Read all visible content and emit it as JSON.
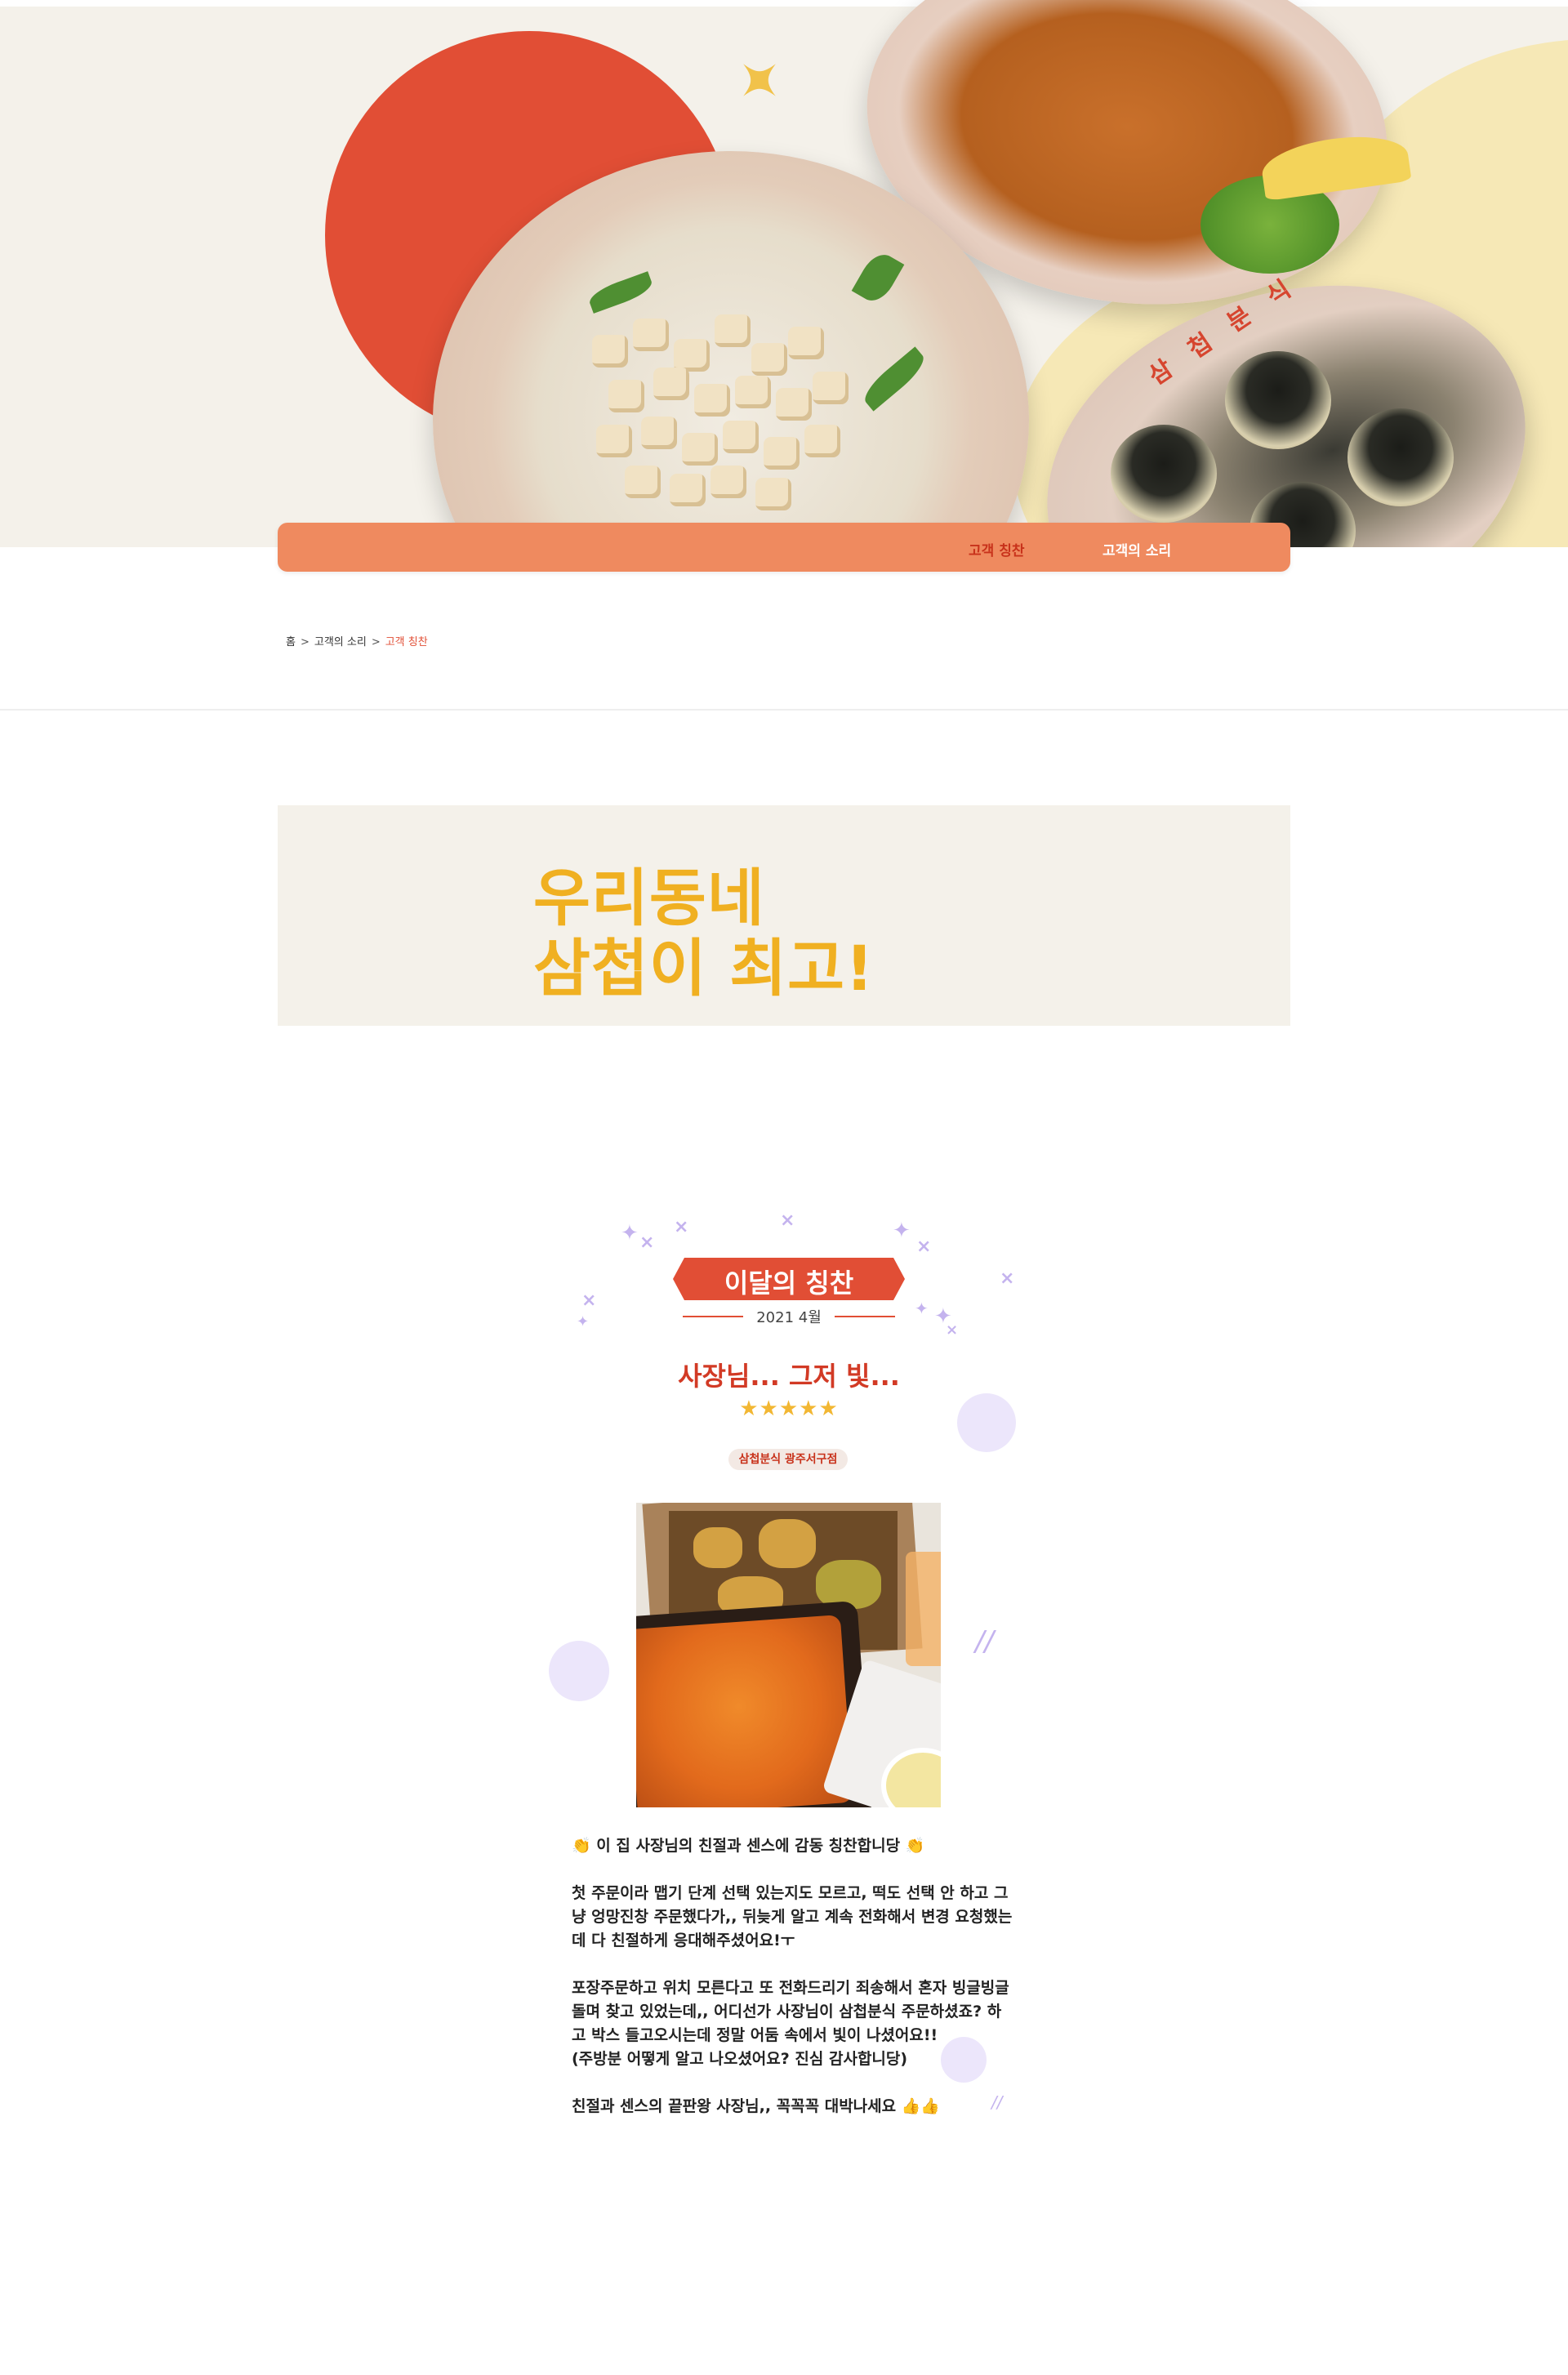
{
  "hero": {
    "brand_text": "삼 첩 분 식",
    "sparkle_icon": "sparkle-icon"
  },
  "nav": {
    "items": [
      {
        "label": "고객 칭찬",
        "active": true
      },
      {
        "label": "고객의 소리",
        "active": false
      }
    ]
  },
  "breadcrumb": {
    "home": "홈",
    "parent": "고객의 소리",
    "current": "고객 칭찬",
    "separator": ">"
  },
  "promo": {
    "line1": "우리동네",
    "line2": "삼첩이 최고!"
  },
  "praise": {
    "badge": "이달의 칭찬",
    "date": "2021 4월",
    "title": "사장님... 그저 빛...",
    "stars": "★★★★★",
    "store": "삼첩분식 광주서구점",
    "body": [
      "👏 이 집 사장님의 친절과 센스에 감동 칭찬합니당 👏",
      "",
      "첫 주문이라 맵기 단계 선택 있는지도 모르고, 떡도 선택 안 하고 그냥 엉망진창 주문했다가,, 뒤늦게 알고 계속 전화해서 변경 요청했는데 다 친절하게 응대해주셨어요!ㅜ",
      "",
      "포장주문하고 위치 모른다고 또 전화드리기 죄송해서 혼자 빙글빙글 돌며 찾고 있었는데,, 어디선가 사장님이 삼첩분식 주문하셨죠? 하고 박스 들고오시는데 정말 어둠 속에서 빛이 나셨어요!!",
      "(주방분 어떻게 알고 나오셨어요? 진심 감사합니당)",
      "",
      "친절과 센스의 끝판왕 사장님,, 꼭꼭꼭 대박나세요 👍👍"
    ]
  },
  "colors": {
    "accent_red": "#e14e35",
    "nav_orange": "#ef8a5f",
    "promo_yellow": "#f0b021",
    "star_yellow": "#f2b733",
    "deco_lavender": "#c4b3ee"
  }
}
